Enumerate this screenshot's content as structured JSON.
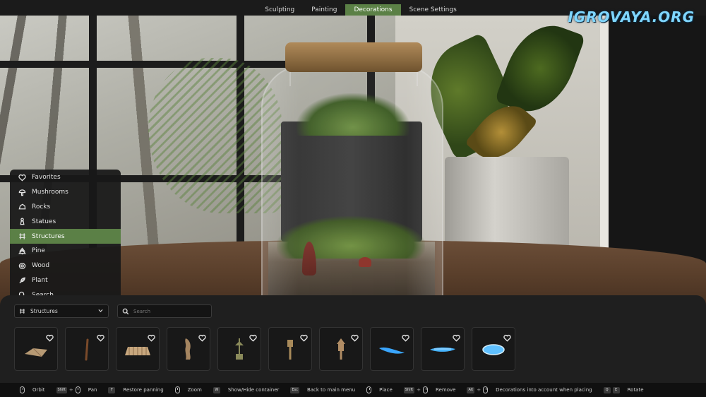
{
  "watermark": "IGROVAYA.ORG",
  "tabs": [
    {
      "label": "Sculpting",
      "active": false
    },
    {
      "label": "Painting",
      "active": false
    },
    {
      "label": "Decorations",
      "active": true
    },
    {
      "label": "Scene Settings",
      "active": false
    }
  ],
  "categories": [
    {
      "label": "Favorites",
      "icon": "heart-icon",
      "active": false
    },
    {
      "label": "Mushrooms",
      "icon": "mushroom-icon",
      "active": false
    },
    {
      "label": "Rocks",
      "icon": "rock-icon",
      "active": false
    },
    {
      "label": "Statues",
      "icon": "statue-icon",
      "active": false
    },
    {
      "label": "Structures",
      "icon": "structure-icon",
      "active": true
    },
    {
      "label": "Pine",
      "icon": "pine-icon",
      "active": false
    },
    {
      "label": "Wood",
      "icon": "wood-icon",
      "active": false
    },
    {
      "label": "Plant",
      "icon": "plant-icon",
      "active": false
    },
    {
      "label": "Search",
      "icon": "search-icon",
      "active": false
    }
  ],
  "category_select": {
    "value": "Structures",
    "icon": "structure-icon"
  },
  "search": {
    "placeholder": "Search"
  },
  "items": [
    {
      "name": "wood-plank",
      "color": "#b79a74"
    },
    {
      "name": "stick",
      "color": "#7a4a2a"
    },
    {
      "name": "wooden-bridge",
      "color": "#c7a77e"
    },
    {
      "name": "log-piece",
      "color": "#a58560"
    },
    {
      "name": "lantern-post",
      "color": "#8a8a5a"
    },
    {
      "name": "lamp-post",
      "color": "#a88a5a"
    },
    {
      "name": "lantern-tower",
      "color": "#b08c64"
    },
    {
      "name": "blue-stream-1",
      "color": "#3aa6ff"
    },
    {
      "name": "blue-stream-2",
      "color": "#48b4ff"
    },
    {
      "name": "blue-pond",
      "color": "#5fc0ff"
    }
  ],
  "hotkeys": [
    {
      "keys": [
        "mouse"
      ],
      "label": "Orbit"
    },
    {
      "keys": [
        "Shift",
        "+",
        "mouse"
      ],
      "label": "Pan"
    },
    {
      "keys": [
        "F"
      ],
      "label": "Restore panning"
    },
    {
      "keys": [
        "mouse"
      ],
      "label": "Zoom"
    },
    {
      "keys": [
        "W"
      ],
      "label": "Show/Hide container"
    },
    {
      "keys": [
        "Esc"
      ],
      "label": "Back to main menu"
    },
    {
      "keys": [
        "mouse"
      ],
      "label": "Place"
    },
    {
      "keys": [
        "Shift",
        "+",
        "mouse"
      ],
      "label": "Remove"
    },
    {
      "keys": [
        "Alt",
        "+",
        "mouse"
      ],
      "label": "Decorations into account when placing"
    },
    {
      "keys": [
        "Q",
        "E"
      ],
      "label": "Rotate"
    }
  ],
  "colors": {
    "accent": "#5b8046",
    "panel": "#1f1f1f"
  }
}
